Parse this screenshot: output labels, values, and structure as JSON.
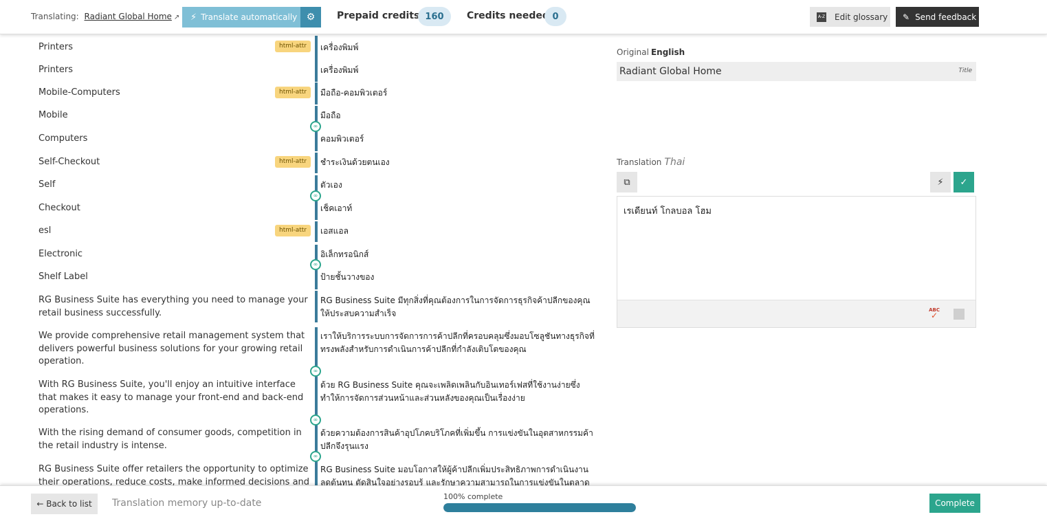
{
  "header": {
    "translating_label": "Translating:",
    "site_name": "Radiant Global Home",
    "translate_auto_label": "Translate automatically",
    "prepaid_label": "Prepaid credits:",
    "prepaid_value": "160",
    "needed_label": "Credits needed",
    "needed_value": "0",
    "glossary_label": "Edit glossary",
    "feedback_label": "Send feedback"
  },
  "segments": [
    {
      "source": "Printers",
      "target": "เครื่องพิมพ์",
      "tag": "html-attr"
    },
    {
      "source": "Printers",
      "target": "เครื่องพิมพ์",
      "tag": ""
    },
    {
      "source": "Mobile-Computers",
      "target": "มือถือ-คอมพิวเตอร์",
      "tag": "html-attr"
    },
    {
      "source": "Mobile",
      "target": "มือถือ",
      "tag": ""
    },
    {
      "source": "Computers",
      "target": "คอมพิวเตอร์",
      "tag": ""
    },
    {
      "source": "Self-Checkout",
      "target": "ชำระเงินด้วยตนเอง",
      "tag": "html-attr"
    },
    {
      "source": "Self",
      "target": "ตัวเอง",
      "tag": ""
    },
    {
      "source": "Checkout",
      "target": "เช็คเอาท์",
      "tag": ""
    },
    {
      "source": "esl",
      "target": "เอสแอล",
      "tag": "html-attr"
    },
    {
      "source": "Electronic",
      "target": "อิเล็กทรอนิกส์",
      "tag": ""
    },
    {
      "source": "Shelf Label",
      "target": "ป้ายชั้นวางของ",
      "tag": ""
    },
    {
      "source": "RG Business Suite has everything you need to manage your retail business successfully.",
      "target": "RG Business Suite มีทุกสิ่งที่คุณต้องการในการจัดการธุรกิจค้าปลีกของคุณให้ประสบความสำเร็จ",
      "tag": ""
    },
    {
      "source": "We provide comprehensive retail management system that delivers powerful business solutions for your growing retail operation.",
      "target": "เราให้บริการระบบการจัดการการค้าปลีกที่ครอบคลุมซึ่งมอบโซลูชันทางธุรกิจที่ทรงพลังสำหรับการดำเนินการค้าปลีกที่กำลังเติบโตของคุณ",
      "tag": ""
    },
    {
      "source": "With RG Business Suite, you'll enjoy an intuitive interface that makes it easy to manage your front-end and back-end operations.",
      "target": "ด้วย RG Business Suite คุณจะเพลิดเพลินกับอินเทอร์เฟสที่ใช้งานง่ายซึ่งทำให้การจัดการส่วนหน้าและส่วนหลังของคุณเป็นเรื่องง่าย",
      "tag": ""
    },
    {
      "source": "With the rising demand of consumer goods, competition in the retail industry is intense.",
      "target": "ด้วยความต้องการสินค้าอุปโภคบริโภคที่เพิ่มขึ้น การแข่งขันในอุตสาหกรรมค้าปลีกจึงรุนแรง",
      "tag": ""
    },
    {
      "source": "RG Business Suite offer retailers the opportunity to optimize their operations, reduce costs, make informed decisions and",
      "target": "RG Business Suite มอบโอกาสให้ผู้ค้าปลีกเพิ่มประสิทธิภาพการดำเนินงาน ลดต้นทุน ตัดสินใจอย่างรอบรู้ และรักษาความสามารถในการแข่งขันในตลาด",
      "tag": ""
    }
  ],
  "panel": {
    "original_label": "Original",
    "original_lang": "English",
    "original_text": "Radiant Global Home",
    "original_type": "Title",
    "translation_label": "Translation",
    "translation_lang": "Thai",
    "translation_text": "เรเดียนท์ โกลบอล โฮม",
    "spellcheck_text": "ABC"
  },
  "footer": {
    "back_label": "← Back to list",
    "tm_status": "Translation memory up-to-date",
    "progress_label": "100% complete",
    "progress_percent": 100,
    "complete_label": "Complete"
  },
  "colors": {
    "accent": "#2ca58d",
    "primary": "#3e8ead",
    "tag": "#f8d57e"
  }
}
